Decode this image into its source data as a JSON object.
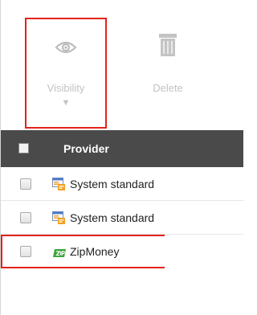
{
  "toolbar": {
    "visibility_label": "Visibility",
    "visibility_caret": "▼",
    "delete_label": "Delete"
  },
  "grid": {
    "column_provider": "Provider",
    "rows": [
      {
        "label": "System standard",
        "icon": "system-standard-icon"
      },
      {
        "label": "System standard",
        "icon": "system-standard-icon"
      },
      {
        "label": "ZipMoney",
        "icon": "zip-logo-icon"
      }
    ]
  },
  "colors": {
    "highlight": "#e2231a",
    "header_bg": "#4a4a4a",
    "disabled_text": "#c2c2c2",
    "zip_green": "#3aa537"
  }
}
